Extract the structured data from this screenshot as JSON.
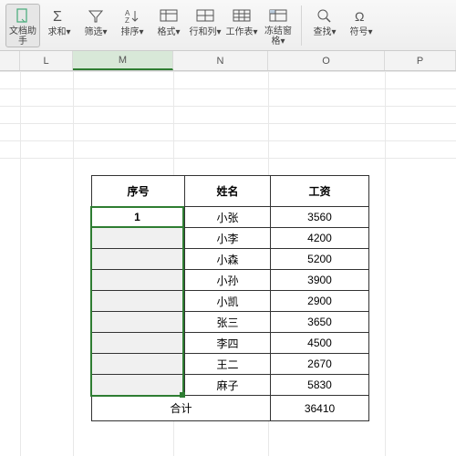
{
  "toolbar": {
    "items": [
      {
        "label": "文档助手",
        "icon": "doc"
      },
      {
        "label": "求和",
        "icon": "sum"
      },
      {
        "label": "筛选",
        "icon": "filter"
      },
      {
        "label": "排序",
        "icon": "sort"
      },
      {
        "label": "格式",
        "icon": "format"
      },
      {
        "label": "行和列",
        "icon": "rowcol"
      },
      {
        "label": "工作表",
        "icon": "sheet"
      },
      {
        "label": "冻结窗格",
        "icon": "freeze"
      },
      {
        "label": "查找",
        "icon": "find"
      },
      {
        "label": "符号",
        "icon": "symbol"
      }
    ]
  },
  "columns": [
    "L",
    "M",
    "N",
    "O",
    "P"
  ],
  "table": {
    "headers": {
      "seq": "序号",
      "name": "姓名",
      "salary": "工资"
    },
    "rows": [
      {
        "seq": "1",
        "name": "小张",
        "salary": "3560"
      },
      {
        "seq": "",
        "name": "小李",
        "salary": "4200"
      },
      {
        "seq": "",
        "name": "小森",
        "salary": "5200"
      },
      {
        "seq": "",
        "name": "小孙",
        "salary": "3900"
      },
      {
        "seq": "",
        "name": "小凯",
        "salary": "2900"
      },
      {
        "seq": "",
        "name": "张三",
        "salary": "3650"
      },
      {
        "seq": "",
        "name": "李四",
        "salary": "4500"
      },
      {
        "seq": "",
        "name": "王二",
        "salary": "2670"
      },
      {
        "seq": "",
        "name": "麻子",
        "salary": "5830"
      }
    ],
    "total": {
      "label": "合计",
      "value": "36410"
    }
  },
  "active_cell_value": "1"
}
